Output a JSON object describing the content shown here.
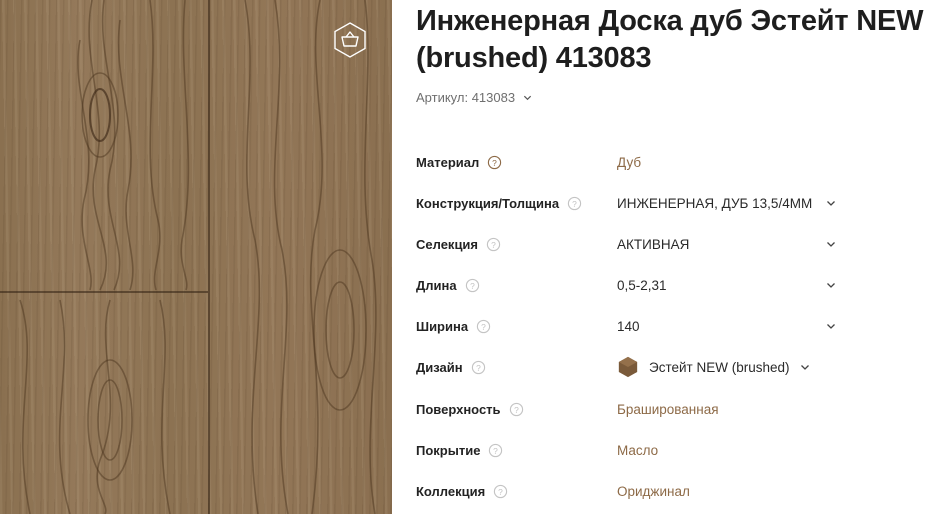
{
  "product": {
    "title": "Инженерная Доска дуб Эстейт NEW (brushed) 413083",
    "sku_label": "Артикул: 413083"
  },
  "colors": {
    "accent": "#8d6a47",
    "swatch": "#7a5a3a"
  },
  "icons": {
    "cart": "basket-icon",
    "help": "help-circle-icon",
    "chevron": "chevron-down-icon"
  },
  "attributes": [
    {
      "label": "Материал",
      "value": "Дуб"
    },
    {
      "label": "Конструкция/Толщина",
      "value": "ИНЖЕНЕРНАЯ, ДУБ 13,5/4ММ"
    },
    {
      "label": "Селекция",
      "value": "АКТИВНАЯ"
    },
    {
      "label": "Длина",
      "value": "0,5-2,31"
    },
    {
      "label": "Ширина",
      "value": "140"
    },
    {
      "label": "Дизайн",
      "value": "Эстейт NEW (brushed)"
    },
    {
      "label": "Поверхность",
      "value": "Брашированная"
    },
    {
      "label": "Покрытие",
      "value": "Масло"
    },
    {
      "label": "Коллекция",
      "value": "Ориджинал"
    }
  ]
}
